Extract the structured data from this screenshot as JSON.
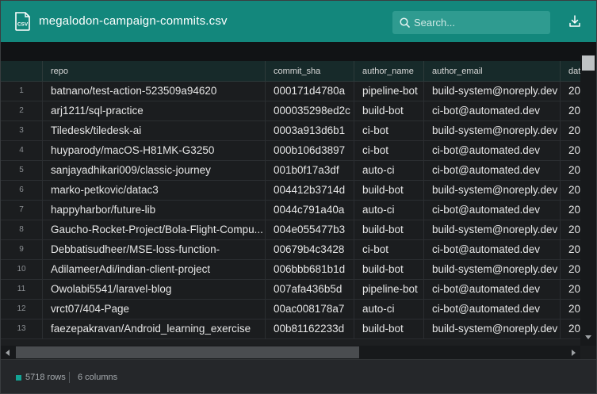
{
  "header": {
    "file_icon_label": "CSV",
    "title": "megalodon-campaign-commits.csv",
    "search_placeholder": "Search...",
    "download_icon": "download-icon",
    "colors": {
      "header_bg": "#13877c",
      "search_bg": "#2f9b90"
    }
  },
  "table": {
    "columns": [
      "repo",
      "commit_sha",
      "author_name",
      "author_email",
      "dat"
    ],
    "rows": [
      {
        "idx": "1",
        "repo": "batnano/test-action-523509a94620",
        "sha": "000171d4780a",
        "name": "pipeline-bot",
        "email": "build-system@noreply.dev",
        "date": "20"
      },
      {
        "idx": "2",
        "repo": "arj1211/sql-practice",
        "sha": "000035298ed2c",
        "name": "build-bot",
        "email": "ci-bot@automated.dev",
        "date": "20"
      },
      {
        "idx": "3",
        "repo": "Tiledesk/tiledesk-ai",
        "sha": "0003a913d6b1",
        "name": "ci-bot",
        "email": "build-system@noreply.dev",
        "date": "20"
      },
      {
        "idx": "4",
        "repo": "huyparody/macOS-H81MK-G3250",
        "sha": "000b106d3897",
        "name": "ci-bot",
        "email": "ci-bot@automated.dev",
        "date": "20"
      },
      {
        "idx": "5",
        "repo": "sanjayadhikari009/classic-journey",
        "sha": "001b0f17a3df",
        "name": "auto-ci",
        "email": "ci-bot@automated.dev",
        "date": "20"
      },
      {
        "idx": "6",
        "repo": "marko-petkovic/datac3",
        "sha": "004412b3714d",
        "name": "build-bot",
        "email": "build-system@noreply.dev",
        "date": "20"
      },
      {
        "idx": "7",
        "repo": "happyharbor/future-lib",
        "sha": "0044c791a40a",
        "name": "auto-ci",
        "email": "ci-bot@automated.dev",
        "date": "20"
      },
      {
        "idx": "8",
        "repo": "Gaucho-Rocket-Project/Bola-Flight-Compu...",
        "sha": "004e055477b3",
        "name": "build-bot",
        "email": "build-system@noreply.dev",
        "date": "20"
      },
      {
        "idx": "9",
        "repo": "Debbatisudheer/MSE-loss-function-",
        "sha": "00679b4c3428",
        "name": "ci-bot",
        "email": "ci-bot@automated.dev",
        "date": "20"
      },
      {
        "idx": "10",
        "repo": "AdilameerAdi/indian-client-project",
        "sha": "006bbb681b1d",
        "name": "build-bot",
        "email": "build-system@noreply.dev",
        "date": "20"
      },
      {
        "idx": "11",
        "repo": "Owolabi5541/laravel-blog",
        "sha": "007afa436b5d",
        "name": "pipeline-bot",
        "email": "ci-bot@automated.dev",
        "date": "20"
      },
      {
        "idx": "12",
        "repo": "vrct07/404-Page",
        "sha": "00ac008178a7",
        "name": "auto-ci",
        "email": "ci-bot@automated.dev",
        "date": "20"
      },
      {
        "idx": "13",
        "repo": "faezepakravan/Android_learning_exercise",
        "sha": "00b81162233d",
        "name": "build-bot",
        "email": "build-system@noreply.dev",
        "date": "20"
      }
    ]
  },
  "footer": {
    "rows_label": "5718 rows",
    "columns_label": "6 columns"
  }
}
